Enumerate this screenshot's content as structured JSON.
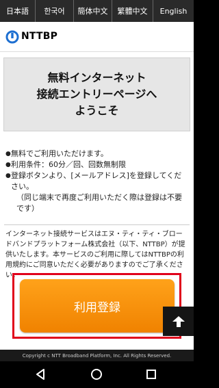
{
  "languages": [
    "日本語",
    "한국어",
    "簡体中文",
    "繁體中文",
    "English"
  ],
  "logo": {
    "text": "NTTBP"
  },
  "hero": {
    "lines": [
      "無料インターネット",
      "接続エントリーページへ",
      "ようこそ"
    ]
  },
  "info": {
    "bullets": [
      "無料でご利用いただけます。",
      "利用条件：60分／回、回数無制限",
      "登録ボタンより、[メールアドレス]を登録してください。"
    ],
    "note": "（同じ端末で再度ご利用いただく際は登録は不要です）"
  },
  "notice": "インターネット接続サービスはエヌ・ティ・ティ・ブロードバンドプラットフォーム株式会社（以下、NTTBP）が提供いたします。本サービスのご利用に際してはNTTBPの利用規約にご同意いただく必要がありますのでご了承ください。",
  "register_button": "利用登録",
  "footer": "Copyright c NTT Broadband Platform, Inc. All Rights Reserved.",
  "colors": {
    "accent": "#f39200",
    "highlight_border": "#e0001b",
    "logo_blue": "#1d6fd1"
  },
  "icons": {
    "scroll_top": "arrow-up-icon",
    "back": "back-triangle-icon",
    "home": "home-circle-icon",
    "recent": "recent-square-icon"
  }
}
